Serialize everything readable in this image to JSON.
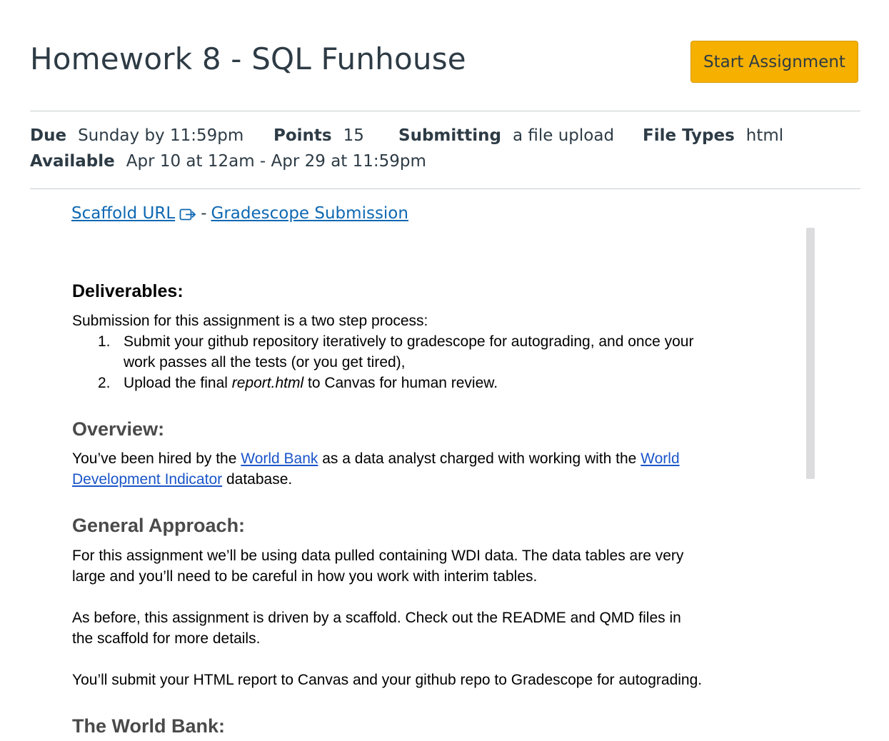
{
  "header": {
    "title": "Homework 8 - SQL Funhouse",
    "start_button": "Start Assignment"
  },
  "details": {
    "due_label": "Due",
    "due_value": "Sunday by 11:59pm",
    "points_label": "Points",
    "points_value": "15",
    "submitting_label": "Submitting",
    "submitting_value": "a file upload",
    "file_types_label": "File Types",
    "file_types_value": "html",
    "available_label": "Available",
    "available_value": "Apr 10 at 12am - Apr 29 at 11:59pm"
  },
  "links": {
    "scaffold": "Scaffold URL",
    "separator": "-",
    "gradescope": "Gradescope Submission"
  },
  "content": {
    "deliverables_heading": "Deliverables:",
    "deliverables_intro": "Submission for this assignment is a two step process:",
    "steps": [
      {
        "num": "1.",
        "line1": "Submit your github repository iteratively to gradescope for autograding, and once your",
        "line2": "work passes all the tests (or you get tired),"
      },
      {
        "num": "2.",
        "pre": "Upload the final ",
        "em": "report.html",
        "post": " to Canvas for human review."
      }
    ],
    "overview_heading": "Overview:",
    "overview": {
      "t1": "You’ve been hired by the ",
      "link1": "World Bank",
      "t2": " as a data analyst charged with working with the ",
      "link2a": "World",
      "link2b": "Development Indicator",
      "t3": " database."
    },
    "approach_heading": "General Approach:",
    "approach_p1_line1": "For this assignment we’ll be using data pulled containing WDI data. The data tables are very",
    "approach_p1_line2": "large and you’ll need to be careful in how you work with interim tables.",
    "approach_p2_line1": "As before, this assignment is driven by a scaffold.  Check out the README and QMD files in",
    "approach_p2_line2": "the scaffold for more details.",
    "approach_p3": "You’ll submit your HTML report to Canvas and your github repo to Gradescope for autograding.",
    "worldbank_heading": "The World Bank:"
  }
}
